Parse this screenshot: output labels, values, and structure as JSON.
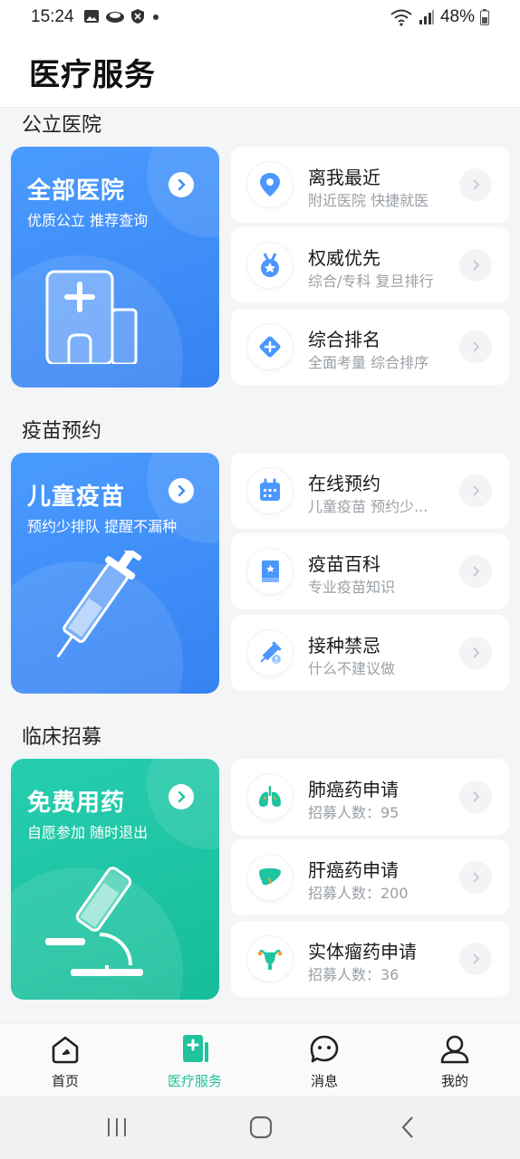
{
  "status_bar": {
    "time": "15:24",
    "battery": "48%"
  },
  "header": {
    "title": "医疗服务"
  },
  "sections": [
    {
      "title": "公立医院",
      "card": {
        "title": "全部医院",
        "subtitle": "优质公立 推荐查询",
        "color": "#3b8cf6",
        "illustration": "hospital-building"
      },
      "items": [
        {
          "title": "离我最近",
          "subtitle": "附近医院 快捷就医",
          "icon": "location-pin-icon"
        },
        {
          "title": "权威优先",
          "subtitle": "综合/专科 复旦排行",
          "icon": "medal-icon"
        },
        {
          "title": "综合排名",
          "subtitle": "全面考量 综合排序",
          "icon": "medical-cross-diamond-icon"
        }
      ]
    },
    {
      "title": "疫苗预约",
      "card": {
        "title": "儿童疫苗",
        "subtitle": "预约少排队 提醒不漏种",
        "color": "#3b8cf6",
        "illustration": "syringe"
      },
      "items": [
        {
          "title": "在线预约",
          "subtitle": "儿童疫苗 预约少...",
          "icon": "calendar-icon"
        },
        {
          "title": "疫苗百科",
          "subtitle": "专业疫苗知识",
          "icon": "book-icon"
        },
        {
          "title": "接种禁忌",
          "subtitle": "什么不建议做",
          "icon": "syringe-warning-icon"
        }
      ]
    },
    {
      "title": "临床招募",
      "card": {
        "title": "免费用药",
        "subtitle": "自愿参加 随时退出",
        "color": "#1fc4a0",
        "illustration": "microscope"
      },
      "items": [
        {
          "title": "肺癌药申请",
          "subtitle": "招募人数：95",
          "icon": "lungs-icon"
        },
        {
          "title": "肝癌药申请",
          "subtitle": "招募人数：200",
          "icon": "liver-icon"
        },
        {
          "title": "实体瘤药申请",
          "subtitle": "招募人数：36",
          "icon": "uterus-icon"
        }
      ]
    }
  ],
  "tabbar": {
    "active_color": "#20c39b",
    "tabs": [
      {
        "label": "首页",
        "icon": "home-icon",
        "active": false
      },
      {
        "label": "医疗服务",
        "icon": "medical-book-icon",
        "active": true
      },
      {
        "label": "消息",
        "icon": "chat-bubble-icon",
        "active": false
      },
      {
        "label": "我的",
        "icon": "user-icon",
        "active": false
      }
    ]
  }
}
